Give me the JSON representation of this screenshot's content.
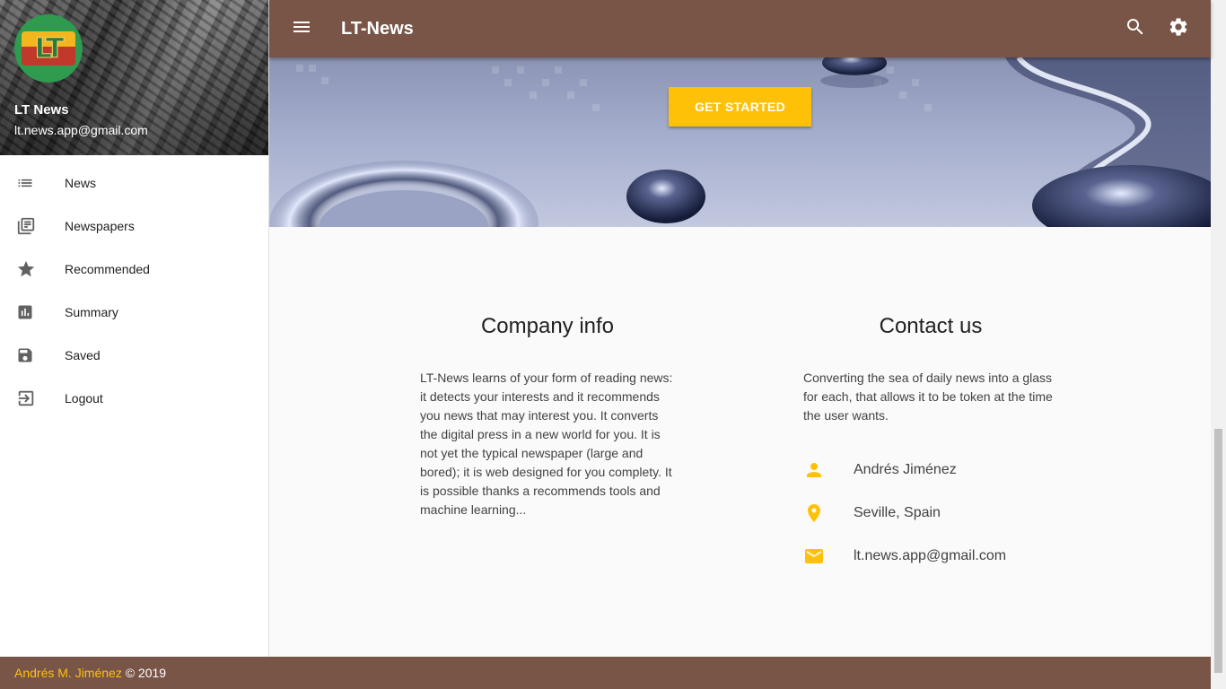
{
  "colors": {
    "brand": "#795548",
    "accent": "#ffc107"
  },
  "drawer": {
    "name": "LT News",
    "email": "lt.news.app@gmail.com",
    "avatar_text": "LT",
    "items": [
      {
        "label": "News",
        "icon": "list-icon"
      },
      {
        "label": "Newspapers",
        "icon": "newspapers-icon"
      },
      {
        "label": "Recommended",
        "icon": "star-icon"
      },
      {
        "label": "Summary",
        "icon": "bar-chart-icon"
      },
      {
        "label": "Saved",
        "icon": "save-icon"
      },
      {
        "label": "Logout",
        "icon": "logout-icon"
      }
    ]
  },
  "toolbar": {
    "title": "LT-News",
    "menu_icon": "menu-icon",
    "search_icon": "search-icon",
    "settings_icon": "gear-icon"
  },
  "hero": {
    "cta_label": "GET STARTED"
  },
  "company": {
    "title": "Company info",
    "text": "LT-News learns of your form of reading news: it detects your interests and it recommends you news that may interest you. It converts the digital press in a new world for you. It is not yet the typical newspaper (large and bored); it is web designed for you complety. It is possible thanks a recommends tools and machine learning..."
  },
  "contact": {
    "title": "Contact us",
    "text": "Converting the sea of daily news into a glass for each, that allows it to be token at the time the user wants.",
    "items": [
      {
        "icon": "person-icon",
        "text": "Andrés Jiménez"
      },
      {
        "icon": "location-pin-icon",
        "text": "Seville, Spain"
      },
      {
        "icon": "mail-icon",
        "text": "lt.news.app@gmail.com"
      }
    ]
  },
  "footer": {
    "author": "Andrés M. Jiménez",
    "copyright": "© 2019"
  }
}
